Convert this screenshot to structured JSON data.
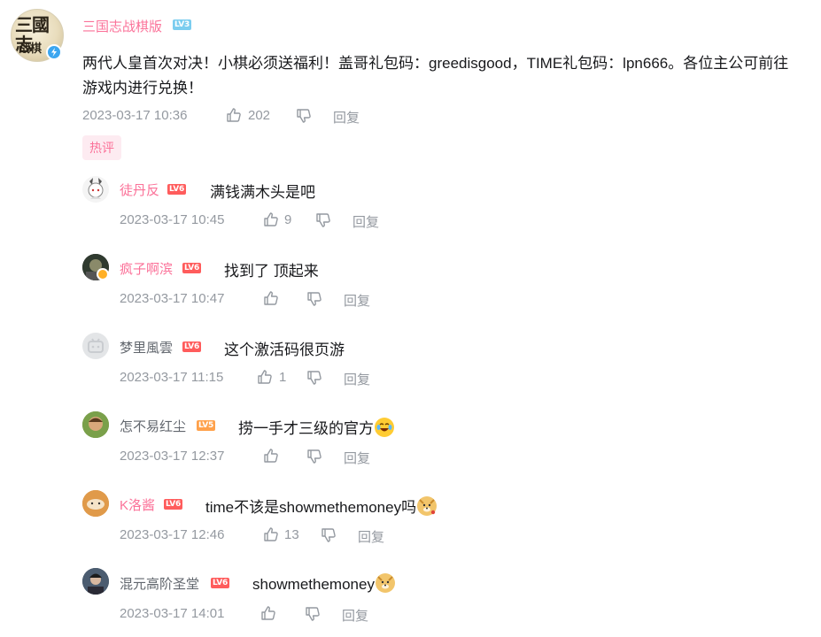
{
  "root_comment": {
    "username": "三国志战棋版",
    "level": "LV3",
    "content": "两代人皇首次对决！小棋必须送福利！盖哥礼包码：greedisgood，TIME礼包码：lpn666。各位主公可前往游戏内进行兑换！",
    "time": "2023-03-17 10:36",
    "likes": "202",
    "reply_label": "回复",
    "avatar_text_top": "三國志",
    "avatar_text_bottom": "战棋"
  },
  "hot_label": "热评",
  "replies": [
    {
      "username": "徒丹反",
      "level": "LV6",
      "content": "满钱满木头是吧",
      "time": "2023-03-17 10:45",
      "likes": "9",
      "reply_label": "回复"
    },
    {
      "username": "疯子啊滨",
      "level": "LV6",
      "content": "找到了 顶起来",
      "time": "2023-03-17 10:47",
      "likes": "",
      "reply_label": "回复"
    },
    {
      "username": "梦里風雲",
      "level": "LV6",
      "content": "这个激活码很页游",
      "time": "2023-03-17 11:15",
      "likes": "1",
      "reply_label": "回复"
    },
    {
      "username": "怎不易红尘",
      "level": "LV5",
      "content": "捞一手才三级的官方",
      "time": "2023-03-17 12:37",
      "likes": "",
      "reply_label": "回复",
      "emoji": "laugh-cry-emoji"
    },
    {
      "username": "K洛酱",
      "level": "LV6",
      "content": "time不该是showmethemoney吗",
      "time": "2023-03-17 12:46",
      "likes": "13",
      "reply_label": "回复",
      "emoji": "doge-emoji"
    },
    {
      "username": "混元高阶圣堂",
      "level": "LV6",
      "content": "showmethemoney",
      "time": "2023-03-17 14:01",
      "likes": "",
      "reply_label": "回复",
      "emoji": "doge-emoji"
    }
  ],
  "colors": {
    "accent_pink": "#fb7299",
    "meta_grey": "#9499a0",
    "lv6": "#ff5c5c",
    "lv5": "#ffa14b",
    "lv3": "#7bcdef"
  }
}
